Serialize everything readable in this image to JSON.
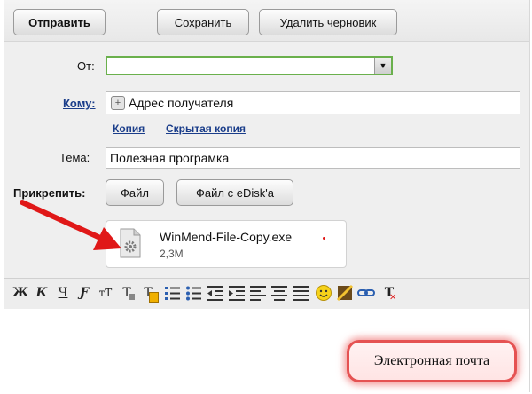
{
  "toolbar": {
    "send_label": "Отправить",
    "save_label": "Сохранить",
    "delete_draft_label": "Удалить черновик"
  },
  "form": {
    "from_label": "От:",
    "from_value": "",
    "to_label": "Кому:",
    "to_placeholder": "Адрес получателя",
    "cc_link": "Копия",
    "bcc_link": "Скрытая копия",
    "subject_label": "Тема:",
    "subject_value": "Полезная програмка",
    "attach_label": "Прикрепить:",
    "file_button": "Файл",
    "edisk_button": "Файл с eDisk'а"
  },
  "attachment": {
    "name": "WinMend-File-Copy.exe",
    "size": "2,3M"
  },
  "editor_toolbar": {
    "buttons": [
      {
        "name": "bold",
        "glyph": "Ж"
      },
      {
        "name": "italic",
        "glyph": "К"
      },
      {
        "name": "underline",
        "glyph": "Ч"
      },
      {
        "name": "font",
        "glyph": "Ƒ"
      },
      {
        "name": "font-size",
        "glyph": "тТ"
      },
      {
        "name": "text-color",
        "glyph": "Т"
      },
      {
        "name": "background-color",
        "glyph": "Т"
      },
      {
        "name": "numbered-list",
        "glyph": ""
      },
      {
        "name": "bulleted-list",
        "glyph": ""
      },
      {
        "name": "outdent",
        "glyph": ""
      },
      {
        "name": "indent",
        "glyph": ""
      },
      {
        "name": "align-left",
        "glyph": ""
      },
      {
        "name": "align-center",
        "glyph": ""
      },
      {
        "name": "align-justify",
        "glyph": ""
      },
      {
        "name": "smiley",
        "glyph": "☺"
      },
      {
        "name": "insert-image",
        "glyph": ""
      },
      {
        "name": "insert-link",
        "glyph": ""
      },
      {
        "name": "clear-format",
        "glyph": "T"
      }
    ]
  },
  "caption": "Электронная почта",
  "colors": {
    "arrow": "#e01818",
    "link": "#1a3d8a",
    "badge_border": "#e55252",
    "from_border": "#6ab04c"
  }
}
